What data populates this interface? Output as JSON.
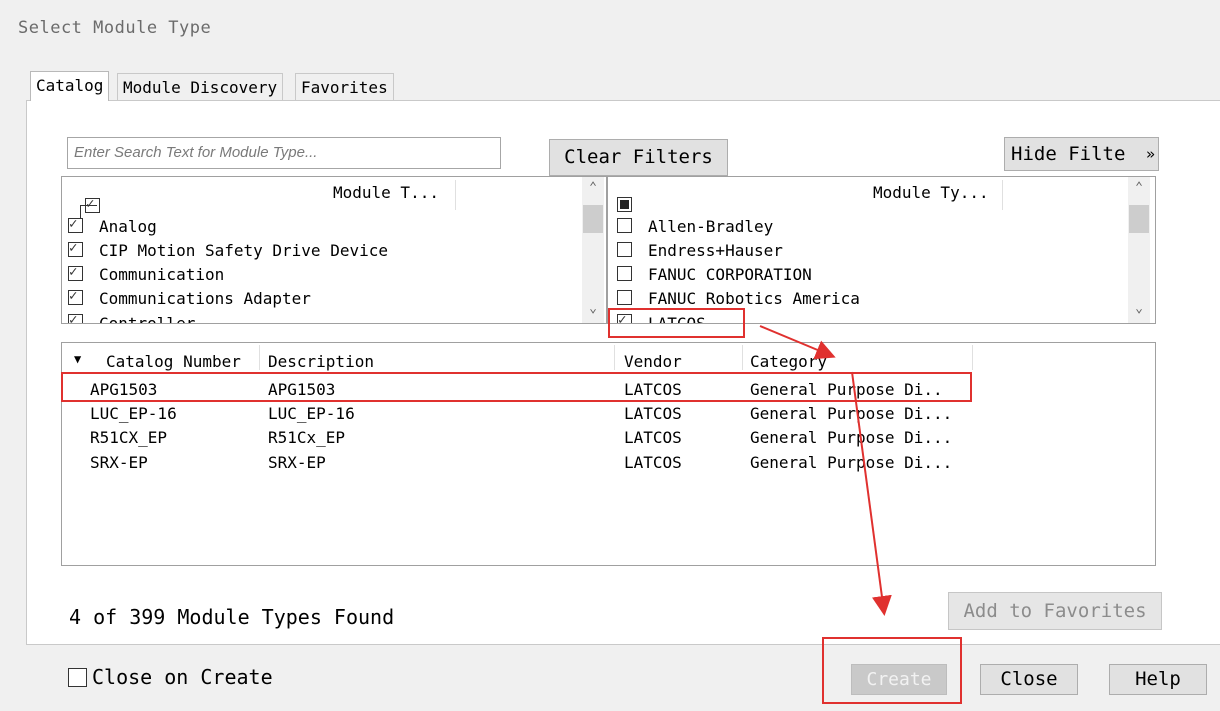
{
  "window": {
    "title": "Select Module Type"
  },
  "tabs": [
    {
      "label": "Catalog",
      "active": true
    },
    {
      "label": "Module Discovery",
      "active": false
    },
    {
      "label": "Favorites",
      "active": false
    }
  ],
  "search": {
    "placeholder": "Enter Search Text for Module Type...",
    "value": ""
  },
  "buttons": {
    "clear_filters": "Clear Filters",
    "hide_filters": "Hide Filte",
    "hide_filters_icon": "double-chevron-up-icon",
    "add_to_favorites": "Add to Favorites",
    "create": "Create",
    "close": "Close",
    "help": "Help"
  },
  "category_filter": {
    "header": "Module T...",
    "items": [
      {
        "label": "Analog",
        "checked": true
      },
      {
        "label": "CIP Motion Safety Drive Device",
        "checked": true
      },
      {
        "label": "Communication",
        "checked": true
      },
      {
        "label": "Communications Adapter",
        "checked": true
      },
      {
        "label": "Controller",
        "checked": true
      }
    ]
  },
  "vendor_filter": {
    "header": "Module Ty...",
    "items": [
      {
        "label": "Allen-Bradley",
        "checked": false
      },
      {
        "label": "Endress+Hauser",
        "checked": false
      },
      {
        "label": "FANUC CORPORATION",
        "checked": false
      },
      {
        "label": "FANUC Robotics America",
        "checked": false
      },
      {
        "label": "LATCOS",
        "checked": true
      }
    ]
  },
  "results": {
    "columns": [
      "Catalog Number",
      "Description",
      "Vendor",
      "Category"
    ],
    "rows": [
      [
        "APG1503",
        "APG1503",
        "LATCOS",
        "General Purpose Di.."
      ],
      [
        "LUC_EP-16",
        "LUC_EP-16",
        "LATCOS",
        "General Purpose Di..."
      ],
      [
        "R51CX_EP",
        "R51Cx_EP",
        "LATCOS",
        "General Purpose Di..."
      ],
      [
        "SRX-EP",
        "SRX-EP",
        "LATCOS",
        "General Purpose Di..."
      ]
    ]
  },
  "status": {
    "found_text": "4 of 399 Module Types Found"
  },
  "options": {
    "close_on_create": "Close on Create",
    "close_on_create_checked": false
  },
  "colors": {
    "annotation_red": "#e0312f",
    "selection_blue": "#1f5fbf"
  }
}
